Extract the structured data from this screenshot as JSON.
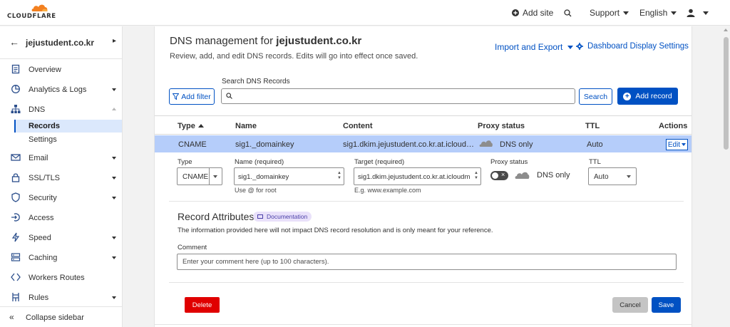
{
  "brand": {
    "logo_text": "CLOUDFLARE",
    "accent": "#f38020"
  },
  "topbar": {
    "add_site": "Add site",
    "support": "Support",
    "language": "English"
  },
  "sidebar": {
    "zone_name": "jejustudent.co.kr",
    "items": [
      {
        "label": "Overview",
        "icon": "document-icon"
      },
      {
        "label": "Analytics & Logs",
        "icon": "chart-icon",
        "expandable": true
      },
      {
        "label": "DNS",
        "icon": "network-icon",
        "expanded": true
      },
      {
        "label": "Email",
        "icon": "email-icon",
        "expandable": true
      },
      {
        "label": "SSL/TLS",
        "icon": "lock-icon",
        "expandable": true
      },
      {
        "label": "Security",
        "icon": "shield-icon",
        "expandable": true
      },
      {
        "label": "Access",
        "icon": "access-icon"
      },
      {
        "label": "Speed",
        "icon": "lightning-icon",
        "expandable": true
      },
      {
        "label": "Caching",
        "icon": "caching-icon",
        "expandable": true
      },
      {
        "label": "Workers Routes",
        "icon": "workers-icon"
      },
      {
        "label": "Rules",
        "icon": "rules-icon",
        "expandable": true
      }
    ],
    "dns_sub": [
      {
        "label": "Records",
        "active": true
      },
      {
        "label": "Settings"
      }
    ],
    "collapse_label": "Collapse sidebar"
  },
  "header": {
    "title_prefix": "DNS management for ",
    "title_domain": "jejustudent.co.kr",
    "description": "Review, add, and edit DNS records. Edits will go into effect once saved.",
    "import_export": "Import and Export",
    "display_settings": "Dashboard Display Settings"
  },
  "search": {
    "label": "Search DNS Records",
    "placeholder": "",
    "filter_button": "Add filter",
    "search_button": "Search",
    "add_record_button": "Add record"
  },
  "table": {
    "columns": [
      "Type",
      "Name",
      "Content",
      "Proxy status",
      "TTL",
      "Actions"
    ],
    "rows": [
      {
        "type": "CNAME",
        "name": "sig1._domainkey",
        "content": "sig1.dkim.jejustudent.co.kr.at.icloud…",
        "proxy": "DNS only",
        "ttl": "Auto",
        "action": "Edit"
      }
    ]
  },
  "edit_form": {
    "type_label": "Type",
    "type_value": "CNAME",
    "name_label": "Name (required)",
    "name_value": "sig1._domainkey",
    "name_hint": "Use @ for root",
    "target_label": "Target (required)",
    "target_value": "sig1.dkim.jejustudent.co.kr.at.icloudm",
    "target_hint": "E.g. www.example.com",
    "proxy_label": "Proxy status",
    "proxy_value": "DNS only",
    "ttl_label": "TTL",
    "ttl_value": "Auto"
  },
  "attributes": {
    "title": "Record Attributes",
    "doc_badge": "Documentation",
    "description": "The information provided here will not impact DNS record resolution and is only meant for your reference.",
    "comment_label": "Comment",
    "comment_placeholder": "Enter your comment here (up to 100 characters)."
  },
  "actions": {
    "delete": "Delete",
    "cancel": "Cancel",
    "save": "Save"
  }
}
